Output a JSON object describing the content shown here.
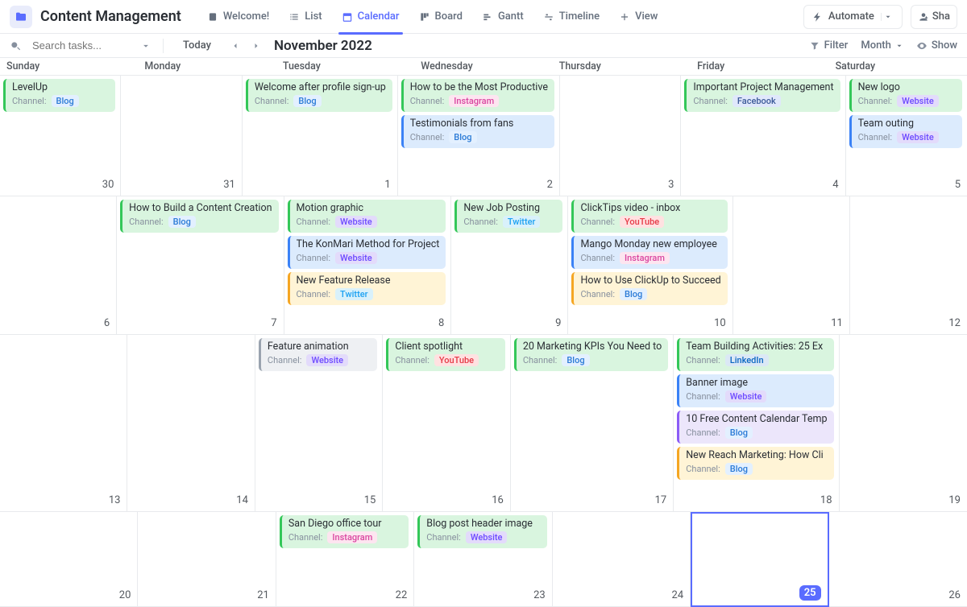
{
  "header": {
    "space_title": "Content Management",
    "views": [
      {
        "label": "Welcome!",
        "icon": "doc"
      },
      {
        "label": "List",
        "icon": "list"
      },
      {
        "label": "Calendar",
        "icon": "calendar",
        "active": true
      },
      {
        "label": "Board",
        "icon": "board"
      },
      {
        "label": "Gantt",
        "icon": "gantt"
      },
      {
        "label": "Timeline",
        "icon": "timeline"
      }
    ],
    "add_view_label": "View",
    "automate_label": "Automate",
    "share_label": "Sha"
  },
  "toolbar": {
    "search_placeholder": "Search tasks...",
    "today_label": "Today",
    "month_title": "November 2022",
    "filter_label": "Filter",
    "month_label": "Month",
    "show_label": "Show"
  },
  "dayheaders": [
    "Sunday",
    "Monday",
    "Tuesday",
    "Wednesday",
    "Thursday",
    "Friday",
    "Saturday"
  ],
  "channel_label": "Channel:",
  "weeks": [
    [
      {
        "date": "30",
        "events": [
          {
            "title": "LevelUp",
            "color": "green",
            "tag": "Blog",
            "tagc": "blog"
          }
        ]
      },
      {
        "date": "31",
        "events": []
      },
      {
        "date": "1",
        "events": [
          {
            "title": "Welcome after profile sign-up",
            "color": "green",
            "tag": "Blog",
            "tagc": "blog"
          }
        ]
      },
      {
        "date": "2",
        "events": [
          {
            "title": "How to be the Most Productive",
            "color": "green",
            "tag": "Instagram",
            "tagc": "insta"
          },
          {
            "title": "Testimonials from fans",
            "color": "blue",
            "tag": "Blog",
            "tagc": "blog"
          }
        ]
      },
      {
        "date": "3",
        "events": []
      },
      {
        "date": "4",
        "events": [
          {
            "title": "Important Project Management",
            "color": "green",
            "tag": "Facebook",
            "tagc": "fb"
          }
        ]
      },
      {
        "date": "5",
        "events": [
          {
            "title": "New logo",
            "color": "green",
            "tag": "Website",
            "tagc": "web"
          },
          {
            "title": "Team outing",
            "color": "blue",
            "tag": "Website",
            "tagc": "web"
          }
        ]
      }
    ],
    [
      {
        "date": "6",
        "events": []
      },
      {
        "date": "7",
        "events": [
          {
            "title": "How to Build a Content Creation",
            "color": "green",
            "tag": "Blog",
            "tagc": "blog"
          }
        ]
      },
      {
        "date": "8",
        "events": [
          {
            "title": "Motion graphic",
            "color": "green",
            "tag": "Website",
            "tagc": "web"
          },
          {
            "title": "The KonMari Method for Project",
            "color": "blue",
            "tag": "Website",
            "tagc": "web"
          },
          {
            "title": "New Feature Release",
            "color": "yellow",
            "tag": "Twitter",
            "tagc": "tw"
          }
        ]
      },
      {
        "date": "9",
        "events": [
          {
            "title": "New Job Posting",
            "color": "green",
            "tag": "Twitter",
            "tagc": "tw"
          }
        ]
      },
      {
        "date": "10",
        "events": [
          {
            "title": "ClickTips video - inbox",
            "color": "green",
            "tag": "YouTube",
            "tagc": "yt"
          },
          {
            "title": "Mango Monday new employee",
            "color": "blue",
            "tag": "Instagram",
            "tagc": "insta"
          },
          {
            "title": "How to Use ClickUp to Succeed",
            "color": "yellow",
            "tag": "Blog",
            "tagc": "blog"
          }
        ]
      },
      {
        "date": "11",
        "events": []
      },
      {
        "date": "12",
        "events": []
      }
    ],
    [
      {
        "date": "13",
        "events": []
      },
      {
        "date": "14",
        "events": []
      },
      {
        "date": "15",
        "events": [
          {
            "title": "Feature animation",
            "color": "gray",
            "tag": "Website",
            "tagc": "web"
          }
        ]
      },
      {
        "date": "16",
        "events": [
          {
            "title": "Client spotlight",
            "color": "green",
            "tag": "YouTube",
            "tagc": "yt"
          }
        ]
      },
      {
        "date": "17",
        "events": [
          {
            "title": "20 Marketing KPIs You Need to",
            "color": "green",
            "tag": "Blog",
            "tagc": "blog"
          }
        ]
      },
      {
        "date": "18",
        "events": [
          {
            "title": "Team Building Activities: 25 Ex",
            "color": "green",
            "tag": "LinkedIn",
            "tagc": "li"
          },
          {
            "title": "Banner image",
            "color": "blue",
            "tag": "Website",
            "tagc": "web"
          },
          {
            "title": "10 Free Content Calendar Temp",
            "color": "purple",
            "tag": "Blog",
            "tagc": "blog"
          },
          {
            "title": "New Reach Marketing: How Cli",
            "color": "yellow",
            "tag": "Blog",
            "tagc": "blog"
          }
        ]
      },
      {
        "date": "19",
        "events": []
      }
    ],
    [
      {
        "date": "20",
        "events": []
      },
      {
        "date": "21",
        "events": []
      },
      {
        "date": "22",
        "events": [
          {
            "title": "San Diego office tour",
            "color": "green",
            "tag": "Instagram",
            "tagc": "insta"
          }
        ]
      },
      {
        "date": "23",
        "events": [
          {
            "title": "Blog post header image",
            "color": "green",
            "tag": "Website",
            "tagc": "web"
          }
        ]
      },
      {
        "date": "24",
        "events": []
      },
      {
        "date": "25",
        "today": true,
        "events": []
      },
      {
        "date": "26",
        "events": []
      }
    ]
  ]
}
